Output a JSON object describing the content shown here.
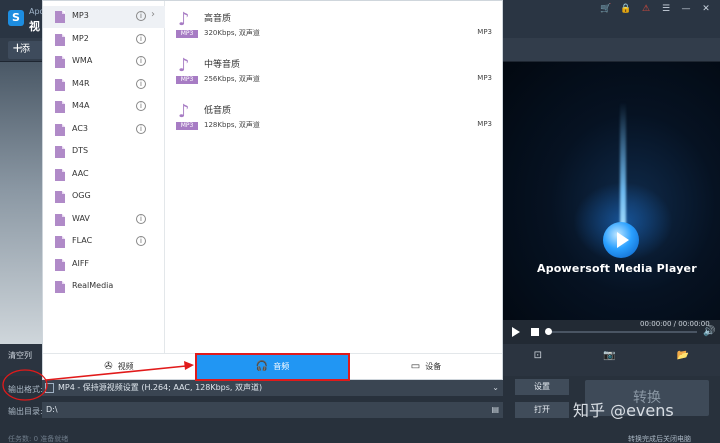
{
  "app": {
    "logo_glyph": "S",
    "subtitle": "Apo",
    "title": "视",
    "window_controls": [
      "🛒",
      "🔒",
      "⚠",
      "☰",
      "—",
      "✕"
    ]
  },
  "toolbar": {
    "add_label": "添"
  },
  "file_list": {
    "clear_label": "清空列"
  },
  "format_dialog": {
    "categories": [
      {
        "label": "MP3",
        "info": true,
        "selected": true
      },
      {
        "label": "MP2",
        "info": true
      },
      {
        "label": "WMA",
        "info": true
      },
      {
        "label": "M4R",
        "info": true
      },
      {
        "label": "M4A",
        "info": true
      },
      {
        "label": "AC3",
        "info": true
      },
      {
        "label": "DTS",
        "info": false
      },
      {
        "label": "AAC",
        "info": false
      },
      {
        "label": "OGG",
        "info": false
      },
      {
        "label": "WAV",
        "info": true
      },
      {
        "label": "FLAC",
        "info": true
      },
      {
        "label": "AIFF",
        "info": false
      },
      {
        "label": "RealMedia",
        "info": false
      }
    ],
    "presets": [
      {
        "name": "高音质",
        "desc": "320Kbps, 双声道",
        "format": "MP3",
        "tag": "MP3"
      },
      {
        "name": "中等音质",
        "desc": "256Kbps, 双声道",
        "format": "MP3",
        "tag": "MP3"
      },
      {
        "name": "低音质",
        "desc": "128Kbps, 双声道",
        "format": "MP3",
        "tag": "MP3"
      }
    ],
    "tabs": {
      "video": "视频",
      "audio": "音频",
      "device": "设备"
    },
    "info_glyph": "i",
    "chevron_glyph": "›",
    "note_glyph": "♪"
  },
  "player": {
    "label": "Apowersoft Media Player",
    "time": "00:00:00 / 00:00:00",
    "volume_glyph": "🔊",
    "tools": [
      "⊡",
      "📷",
      "📂"
    ]
  },
  "output": {
    "format_label": "输出格式:",
    "format_value": "MP4 - 保持源视频设置 (H.264; AAC, 128Kbps, 双声道)",
    "dir_label": "输出目录:",
    "dir_value": "D:\\",
    "settings_btn": "设置",
    "open_btn": "打开",
    "convert_btn": "转换",
    "status_left": "任务数: 0    准备就绪",
    "shutdown_label": "转换完成后关闭电脑"
  },
  "watermark": "知乎 @evens",
  "colors": {
    "accent": "#2196f3",
    "annotation": "#e11a1a",
    "file_icon": "#b08ac8"
  }
}
